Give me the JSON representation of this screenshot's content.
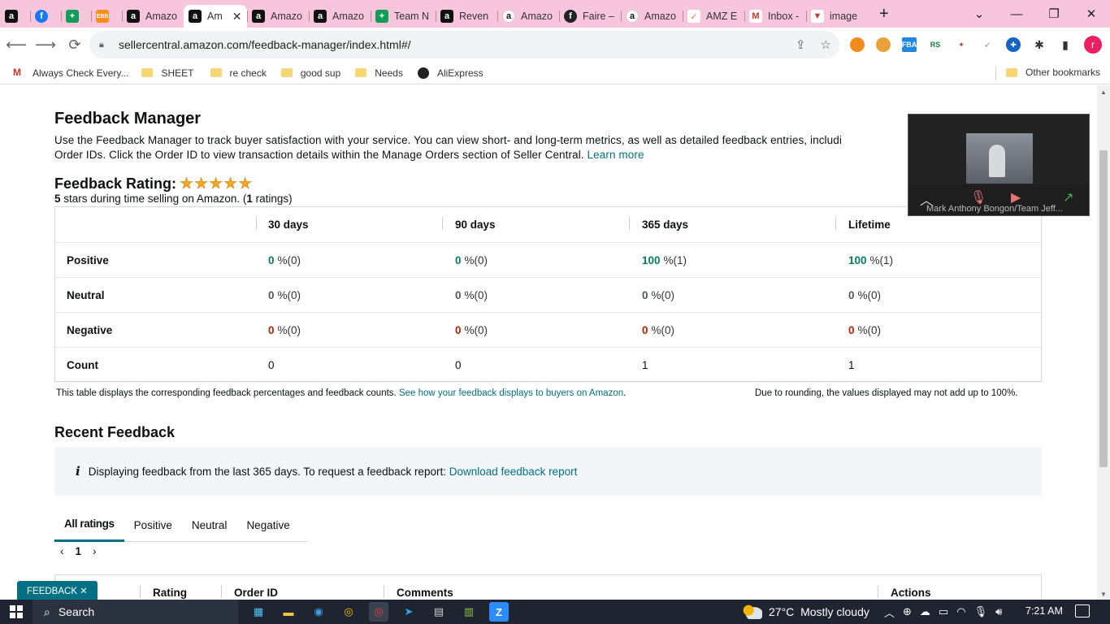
{
  "browser": {
    "tabs": [
      {
        "label": "",
        "icon": "amazon-icon",
        "glyph": "a"
      },
      {
        "label": "",
        "icon": "facebook-icon",
        "glyph": "f"
      },
      {
        "label": "",
        "icon": "sheets-icon",
        "glyph": "+"
      },
      {
        "label": "",
        "icon": "ebb-icon",
        "glyph": "EBB"
      },
      {
        "label": "Amazo",
        "icon": "amazon-icon",
        "glyph": "a"
      },
      {
        "label": "Am",
        "icon": "amazon-icon",
        "glyph": "a",
        "active": true
      },
      {
        "label": "Amazo",
        "icon": "amazon-icon",
        "glyph": "a"
      },
      {
        "label": "Amazo",
        "icon": "amazon-icon",
        "glyph": "a"
      },
      {
        "label": "Team N",
        "icon": "sheets-icon",
        "glyph": "+"
      },
      {
        "label": "Reven",
        "icon": "amazon-icon",
        "glyph": "a"
      },
      {
        "label": "Amazo",
        "icon": "amazon-smile-icon",
        "glyph": "a"
      },
      {
        "label": "Faire –",
        "icon": "faire-icon",
        "glyph": "f"
      },
      {
        "label": "Amazo",
        "icon": "amazon-smile-icon",
        "glyph": "a"
      },
      {
        "label": "AMZ E",
        "icon": "amz-ext-icon",
        "glyph": "✓"
      },
      {
        "label": "Inbox -",
        "icon": "gmail-icon",
        "glyph": "M"
      },
      {
        "label": "image",
        "icon": "image-icon",
        "glyph": "▼"
      }
    ],
    "close_glyph": "✕",
    "new_tab_glyph": "+",
    "window_controls": {
      "dropdown": "⌄",
      "minimize": "—",
      "restore": "❐",
      "close": "✕"
    },
    "url": "sellercentral.amazon.com/feedback-manager/index.html#/",
    "bookmarks": [
      "Always Check Every...",
      "SHEET",
      "re check",
      "good sup",
      "Needs",
      "AliExpress"
    ],
    "other_bookmarks": "Other bookmarks",
    "profile_initial": "r"
  },
  "page": {
    "title": "Feedback Manager",
    "description": "Use the Feedback Manager to track buyer satisfaction with your service. You can view short- and long-term metrics, as well as detailed feedback entries, includi",
    "description_line2": "Order IDs. Click the Order ID to view transaction details within the Manage Orders section of Seller Central.",
    "learn_more": "Learn more",
    "rating_title": "Feedback Rating:",
    "stars": 5,
    "stars_glyphs": "★★★★★",
    "rating_sub_bold": "5",
    "rating_sub_text": " stars during time selling on Amazon. (",
    "rating_sub_count": "1",
    "rating_sub_end": " ratings)",
    "table": {
      "headers": [
        "30 days",
        "90 days",
        "365 days",
        "Lifetime"
      ],
      "rows": [
        {
          "label": "Positive",
          "values": [
            "0",
            "0",
            "100",
            "100"
          ],
          "suffix": [
            "%(0)",
            "%(0)",
            "%(1)",
            "%(1)"
          ],
          "tone": "green"
        },
        {
          "label": "Neutral",
          "values": [
            "0",
            "0",
            "0",
            "0"
          ],
          "suffix": [
            "%(0)",
            "%(0)",
            "%(0)",
            "%(0)"
          ],
          "tone": "grey"
        },
        {
          "label": "Negative",
          "values": [
            "0",
            "0",
            "0",
            "0"
          ],
          "suffix": [
            "%(0)",
            "%(0)",
            "%(0)",
            "%(0)"
          ],
          "tone": "red"
        },
        {
          "label": "Count",
          "values": [
            "0",
            "0",
            "1",
            "1"
          ],
          "suffix": [
            "",
            "",
            "",
            ""
          ],
          "tone": "plain"
        }
      ]
    },
    "table_note": "This table displays the corresponding feedback percentages and feedback counts.",
    "table_note_link": "See how your feedback displays to buyers on Amazon",
    "table_note_right": "Due to rounding, the values displayed may not add up to 100%.",
    "recent_title": "Recent Feedback",
    "info_icon": "i",
    "info_text": "Displaying feedback from the last 365 days. To request a feedback report:",
    "info_link": "Download feedback report",
    "filter_tabs": [
      "All ratings",
      "Positive",
      "Neutral",
      "Negative"
    ],
    "pager": {
      "prev": "‹",
      "page": "1",
      "next": "›"
    },
    "list_headers": [
      "e",
      "Rating",
      "Order ID",
      "Comments",
      "Actions"
    ],
    "feedback_badge": "FEEDBACK ✕"
  },
  "video": {
    "name": "Mark Anthony Bongon/Team Jeff..."
  },
  "taskbar": {
    "search_placeholder": "Search",
    "weather_temp": "27°C",
    "weather_text": "Mostly cloudy",
    "time": "7:21 AM"
  }
}
